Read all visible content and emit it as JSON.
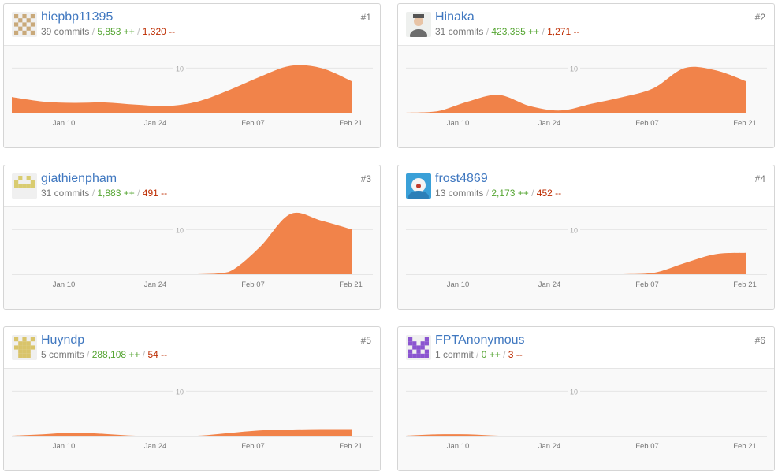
{
  "contributors": [
    {
      "rank": "#1",
      "username": "hiepbp11395",
      "commits": "39 commits",
      "additions": "5,853 ++",
      "deletions": "1,320 --",
      "avatar": "identicon-avatar",
      "avatar_color": "#c9a97a",
      "weekly_commits": [
        3.5,
        2.5,
        2.2,
        2.3,
        1.8,
        1.5,
        2.5,
        5.0,
        8.0,
        10.5,
        10.0,
        7.0
      ]
    },
    {
      "rank": "#2",
      "username": "Hinaka",
      "commits": "31 commits",
      "additions": "423,385 ++",
      "deletions": "1,271 --",
      "avatar": "photo-avatar",
      "avatar_color": "#8a8a8a",
      "weekly_commits": [
        0.0,
        0.3,
        2.5,
        4.0,
        1.5,
        0.5,
        2.0,
        3.5,
        5.5,
        10.0,
        9.5,
        7.0
      ]
    },
    {
      "rank": "#3",
      "username": "giathienpham",
      "commits": "31 commits",
      "additions": "1,883 ++",
      "deletions": "491 --",
      "avatar": "identicon-avatar",
      "avatar_color": "#d9cc70",
      "weekly_commits": [
        0,
        0,
        0,
        0,
        0,
        0,
        0,
        0.5,
        6.0,
        13.5,
        12.0,
        10.0
      ]
    },
    {
      "rank": "#4",
      "username": "frost4869",
      "commits": "13 commits",
      "additions": "2,173 ++",
      "deletions": "452 --",
      "avatar": "photo-avatar",
      "avatar_color": "#3aa0d8",
      "weekly_commits": [
        0,
        0,
        0,
        0,
        0,
        0,
        0,
        0,
        0.3,
        2.5,
        4.5,
        4.8
      ]
    },
    {
      "rank": "#5",
      "username": "Huyndp",
      "commits": "5 commits",
      "additions": "288,108 ++",
      "deletions": "54 --",
      "avatar": "identicon-avatar",
      "avatar_color": "#d9c46a",
      "weekly_commits": [
        0,
        0.3,
        0.7,
        0.4,
        0,
        0,
        0,
        0.6,
        1.2,
        1.4,
        1.5,
        1.5
      ]
    },
    {
      "rank": "#6",
      "username": "FPTAnonymous",
      "commits": "1 commit",
      "additions": "0 ++",
      "deletions": "3 --",
      "avatar": "identicon-avatar",
      "avatar_color": "#8b55d0",
      "weekly_commits": [
        0,
        0.3,
        0.3,
        0,
        0,
        0,
        0,
        0,
        0,
        0,
        0,
        0
      ]
    }
  ],
  "axis": {
    "y_tick": "10",
    "y_max": 15,
    "x_ticks": [
      "Jan 10",
      "Jan 24",
      "Feb 07",
      "Feb 21"
    ]
  },
  "chart_data": {
    "type": "area",
    "x": [
      "Jan 03",
      "Jan 10",
      "Jan 17",
      "Jan 24",
      "Jan 31",
      "Feb 07",
      "Feb 14",
      "Feb 21"
    ],
    "ylim": [
      0,
      15
    ],
    "grid": true,
    "series": [
      {
        "name": "hiepbp11395",
        "values": [
          3.5,
          2.5,
          2.3,
          1.5,
          5.0,
          8.0,
          10.5,
          7.0
        ]
      },
      {
        "name": "Hinaka",
        "values": [
          0.0,
          2.5,
          4.0,
          0.5,
          2.0,
          5.5,
          10.0,
          7.0
        ]
      },
      {
        "name": "giathienpham",
        "values": [
          0,
          0,
          0,
          0,
          0,
          6.0,
          13.5,
          10.0
        ]
      },
      {
        "name": "frost4869",
        "values": [
          0,
          0,
          0,
          0,
          0,
          0.3,
          2.5,
          4.8
        ]
      },
      {
        "name": "Huyndp",
        "values": [
          0,
          0.7,
          0.4,
          0,
          0.6,
          1.2,
          1.4,
          1.5
        ]
      },
      {
        "name": "FPTAnonymous",
        "values": [
          0,
          0.3,
          0.3,
          0,
          0,
          0,
          0,
          0
        ]
      }
    ]
  },
  "colors": {
    "area": "#f1834a",
    "link": "#4078c0",
    "additions": "#55a532",
    "deletions": "#bd2c00",
    "grid": "#e6e6e6",
    "tick_text": "#777777"
  }
}
